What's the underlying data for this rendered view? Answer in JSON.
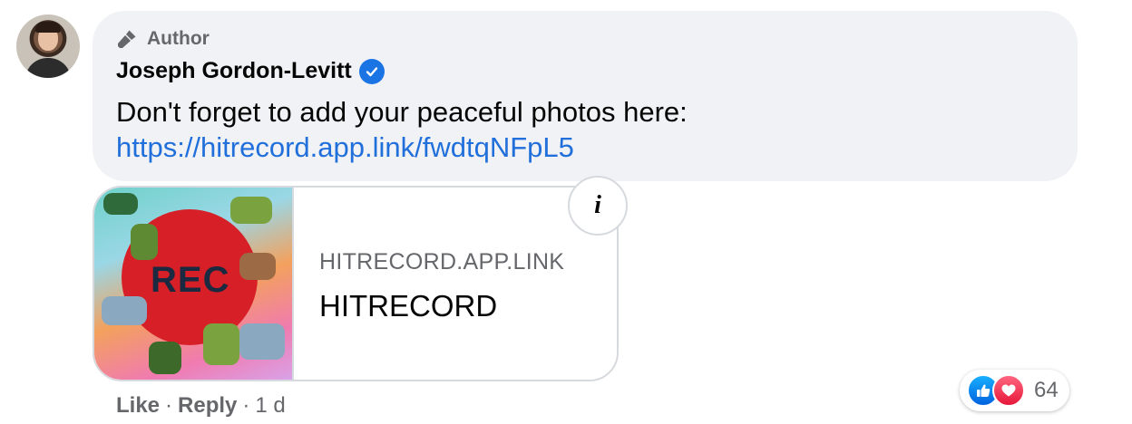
{
  "comment": {
    "badge_label": "Author",
    "author_name": "Joseph Gordon-Levitt",
    "text": "Don't forget to add your peaceful photos here:",
    "link_text": "https://hitrecord.app.link/fwdtqNFpL5"
  },
  "link_preview": {
    "image_text": "REC",
    "domain": "HITRECORD.APP.LINK",
    "title": "HITRECORD",
    "info_icon_label": "i"
  },
  "actions": {
    "like_label": "Like",
    "separator": "·",
    "reply_label": "Reply",
    "time": "1 d"
  },
  "reactions": {
    "icons": [
      "like-icon",
      "love-icon"
    ],
    "count": "64"
  },
  "colors": {
    "bubble_bg": "#f0f2f5",
    "link": "#216fdb",
    "secondary_text": "#65676b",
    "verified_blue": "#1b74e4"
  }
}
